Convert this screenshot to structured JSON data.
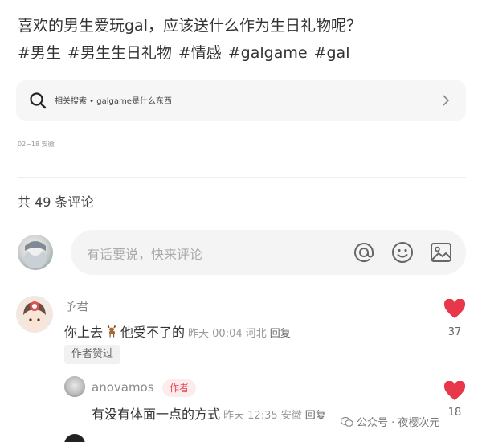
{
  "post": {
    "title": "喜欢的男生爱玩gal，应该送什么作为生日礼物呢？",
    "tags": [
      "#男生",
      "#男生生日礼物",
      "#情感",
      "#galgame",
      "#gal"
    ],
    "related_search": "相关搜索 • galgame是什么东西",
    "meta": "02−18  安徽"
  },
  "comments_header": "共 49 条评论",
  "input": {
    "placeholder": "有话要说，快来评论"
  },
  "comments": [
    {
      "name": "予君",
      "text_before": "你上去",
      "text_after": "他受不了的",
      "meta": "昨天 00:04 河北",
      "reply": "回复",
      "badge": "作者赞过",
      "likes": "37"
    },
    {
      "name": "anovamos",
      "author_tag": "作者",
      "text": "有没有体面一点的方式",
      "meta": "昨天 12:35 安徽",
      "reply": "回复",
      "likes": "18"
    }
  ],
  "watermark": "公众号 · 夜樱次元",
  "colors": {
    "like": "#e8364b",
    "author_badge": "#e0455a"
  }
}
